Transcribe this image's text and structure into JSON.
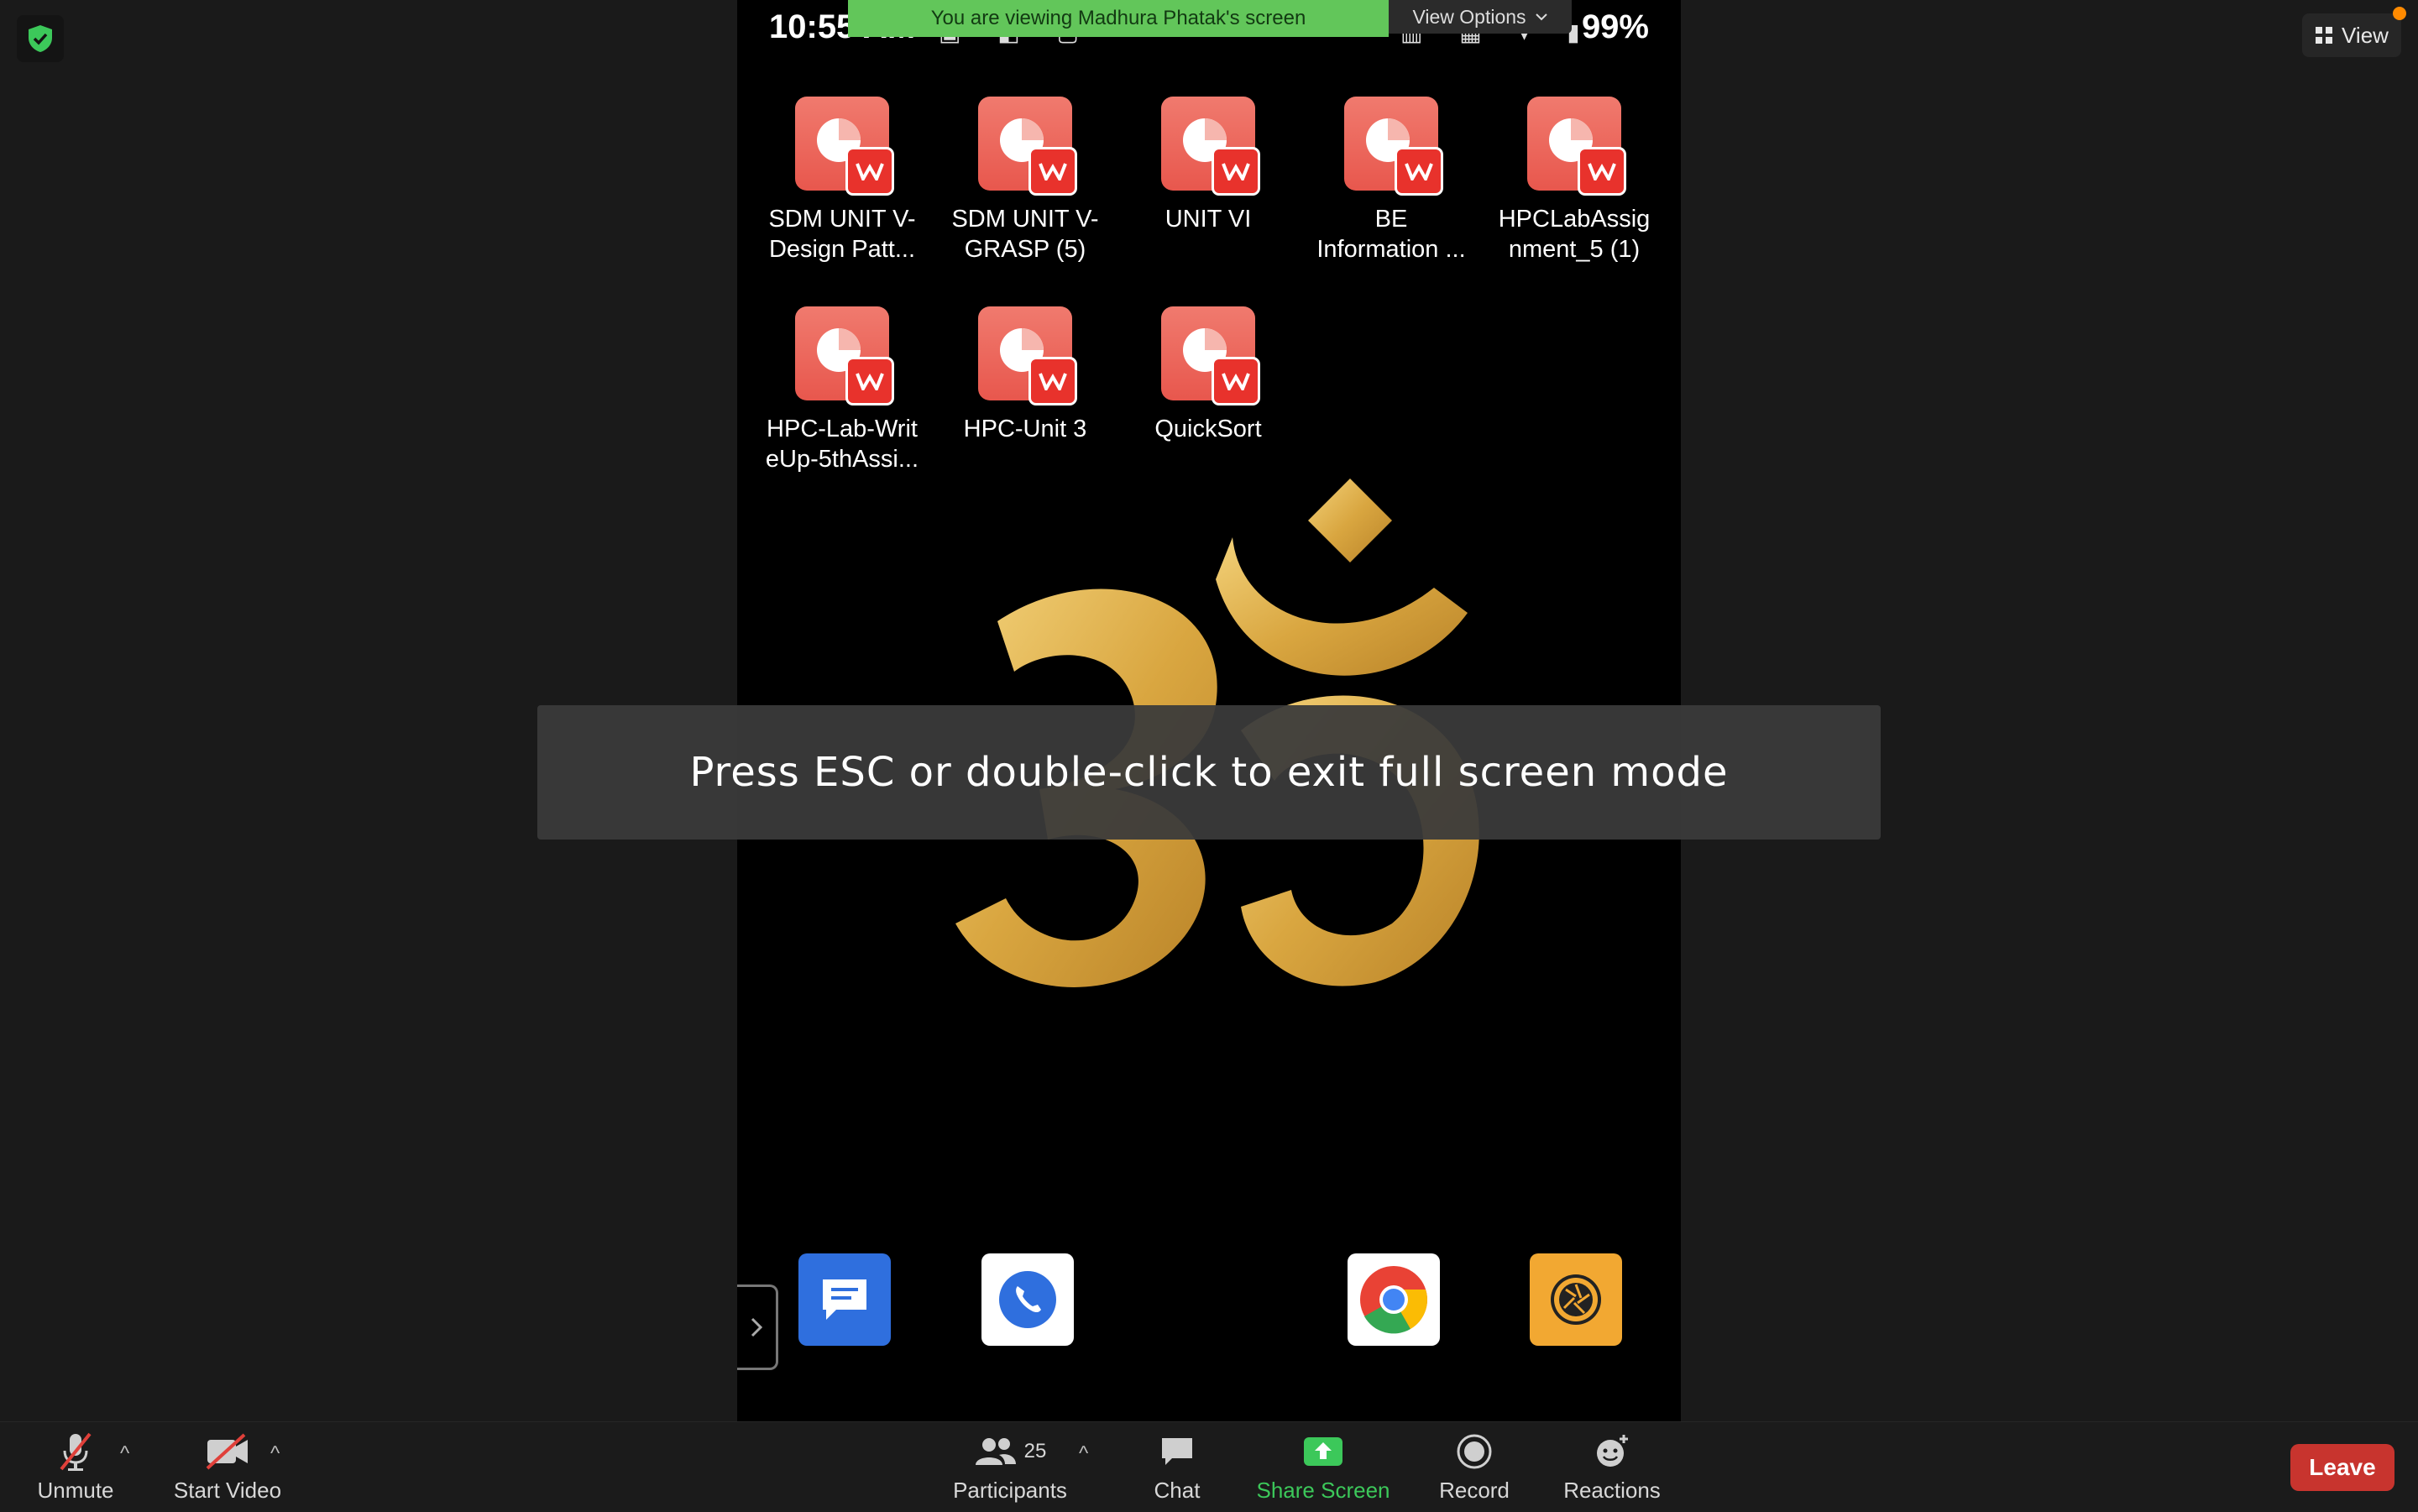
{
  "banner": {
    "text": "You are viewing Madhura Phatak's screen",
    "view_options": "View Options"
  },
  "view_button": "View",
  "phone": {
    "time": "10:55 AM",
    "battery": "99%",
    "apps": [
      {
        "label_line1": "SDM UNIT V-",
        "label_line2": "Design Patt..."
      },
      {
        "label_line1": "SDM UNIT V-",
        "label_line2": "GRASP (5)"
      },
      {
        "label_line1": "UNIT VI",
        "label_line2": ""
      },
      {
        "label_line1": "BE",
        "label_line2": "Information ..."
      },
      {
        "label_line1": "HPCLabAssig",
        "label_line2": "nment_5 (1)"
      },
      {
        "label_line1": "HPC-Lab-Writ",
        "label_line2": "eUp-5thAssi..."
      },
      {
        "label_line1": "HPC-Unit 3",
        "label_line2": ""
      },
      {
        "label_line1": "QuickSort",
        "label_line2": ""
      }
    ]
  },
  "toast": "Press ESC or double-click to exit full screen mode",
  "toolbar": {
    "unmute": "Unmute",
    "start_video": "Start Video",
    "participants": "Participants",
    "participants_count": "25",
    "chat": "Chat",
    "share_screen": "Share Screen",
    "record": "Record",
    "reactions": "Reactions",
    "leave": "Leave"
  },
  "colors": {
    "banner": "#62c65a",
    "leave": "#c8342e",
    "share": "#3cc85a",
    "wps_red": "#e8322c"
  }
}
